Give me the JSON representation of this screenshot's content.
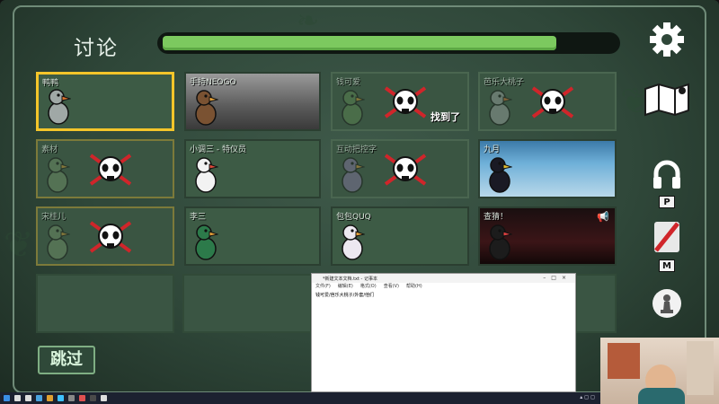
{
  "screen": {
    "title": "讨论",
    "timer_progress": 0.87
  },
  "players": [
    {
      "name": "鸭鸭",
      "status": "alive",
      "selected": true,
      "avatar": "grey-goose"
    },
    {
      "name": "手持NEOGO",
      "status": "alive",
      "avatar": "brown-duck"
    },
    {
      "name": "钱可爱",
      "status": "dead",
      "found_label": "找到了",
      "avatar": "green-duck"
    },
    {
      "name": "芭乐大桃子",
      "status": "dead",
      "avatar": "grey-goose"
    },
    {
      "name": "素材",
      "status": "dead",
      "avatar": "green-goose"
    },
    {
      "name": "小调三 - 特仪员",
      "status": "alive",
      "avatar": "chef-goose"
    },
    {
      "name": "互动把控字",
      "status": "dead",
      "avatar": "purple-goose"
    },
    {
      "name": "九月",
      "status": "alive",
      "avatar": "crow"
    },
    {
      "name": "宋桂儿",
      "status": "dead",
      "avatar": "green-goose"
    },
    {
      "name": "李三",
      "status": "alive",
      "avatar": "mallard"
    },
    {
      "name": "包包QUQ",
      "status": "alive",
      "avatar": "white-goose"
    },
    {
      "name": "查猜！",
      "status": "alive",
      "speaking": true,
      "avatar": "black-goose"
    }
  ],
  "skip_button": {
    "label": "跳过"
  },
  "toolbar": {
    "settings_icon": "gear-icon",
    "map_icon": "map-icon",
    "headphones_icon": "headphones-icon",
    "headphones_key": "P",
    "mic_icon": "mic-muted-icon",
    "mic_key": "M",
    "chess_icon": "pawn-icon"
  },
  "notepad": {
    "title": "*新建文本文档.txt - 记事本",
    "menu": [
      "文件(F)",
      "编辑(E)",
      "格式(O)",
      "查看(V)",
      "帮助(H)"
    ],
    "text": "钱可爱/芭乐大桃子/外套/他们"
  },
  "colors": {
    "accent_green": "#7cc95f",
    "selected_yellow": "#f4c52a",
    "dead_x_red": "#d0252a"
  }
}
